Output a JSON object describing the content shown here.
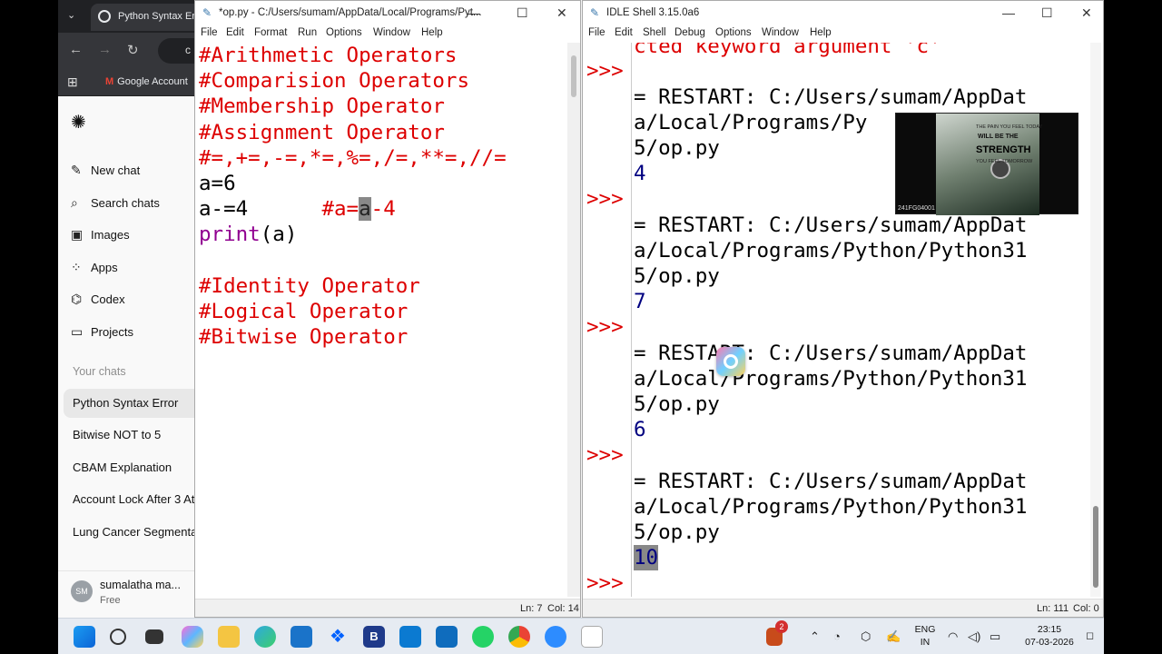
{
  "browser": {
    "tab_title": "Python Syntax Error",
    "omnibox_text": "c",
    "bookmark": "Google Account",
    "nav": [
      {
        "label": "New chat",
        "icon": "edit-icon"
      },
      {
        "label": "Search chats",
        "icon": "search-icon"
      },
      {
        "label": "Images",
        "icon": "image-icon"
      },
      {
        "label": "Apps",
        "icon": "apps-icon"
      },
      {
        "label": "Codex",
        "icon": "codex-icon"
      },
      {
        "label": "Projects",
        "icon": "folder-icon"
      }
    ],
    "section_label": "Your chats",
    "chats": [
      "Python Syntax Error",
      "Bitwise NOT to 5",
      "CBAM Explanation",
      "Account Lock After 3 Attempts",
      "Lung Cancer Segmentation"
    ],
    "profile": {
      "initials": "SM",
      "name": "sumalatha ma...",
      "plan": "Free"
    }
  },
  "editor": {
    "title": "*op.py - C:/Users/sumam/AppData/Local/Programs/Pyt...",
    "menus": [
      "File",
      "Edit",
      "Format",
      "Run",
      "Options",
      "Window",
      "Help"
    ],
    "lines": {
      "l1": "#Arithmetic Operators",
      "l2": "#Comparision Operators",
      "l3": "#Membership Operator",
      "l4": "#Assignment Operator",
      "l5": "#=,+=,-=,*=,%=,/=,**=,//=",
      "l6": "a=6",
      "l7_code": "a-=4",
      "l7_cmt_a": "#a=",
      "l7_cmt_sel": "a",
      "l7_cmt_b": "-4",
      "l8_kw": "print",
      "l8_rest": "(a)",
      "l10": "#Identity Operator",
      "l11": "#Logical Operator",
      "l12": "#Bitwise Operator"
    },
    "status_ln": "Ln: 7",
    "status_col": "Col: 14"
  },
  "shell": {
    "title": "IDLE Shell 3.15.0a6",
    "menus": [
      "File",
      "Edit",
      "Shell",
      "Debug",
      "Options",
      "Window",
      "Help"
    ],
    "prompt": ">>>",
    "top_error": "cted keyword argument 'c'",
    "restart_1": "= RESTART: C:/Users/sumam/AppDat",
    "restart_2": "a/Local/Programs/Python/Python31",
    "restart_2_short": "a/Local/Programs/Py",
    "restart_3": "5/op.py",
    "outputs": [
      "4",
      "7",
      "6",
      "10"
    ],
    "status_ln": "Ln: 111",
    "status_col": "Col: 0"
  },
  "overlay": {
    "line1": "THE PAIN YOU FEEL TODAY",
    "line2": "WILL BE THE",
    "line3": "STRENGTH",
    "line4": "YOU FEEL TOMORROW",
    "id": "241FG04001"
  },
  "taskbar": {
    "notif_badge": "2",
    "lang_1": "ENG",
    "lang_2": "IN",
    "time": "23:15",
    "date": "07-03-2026"
  }
}
